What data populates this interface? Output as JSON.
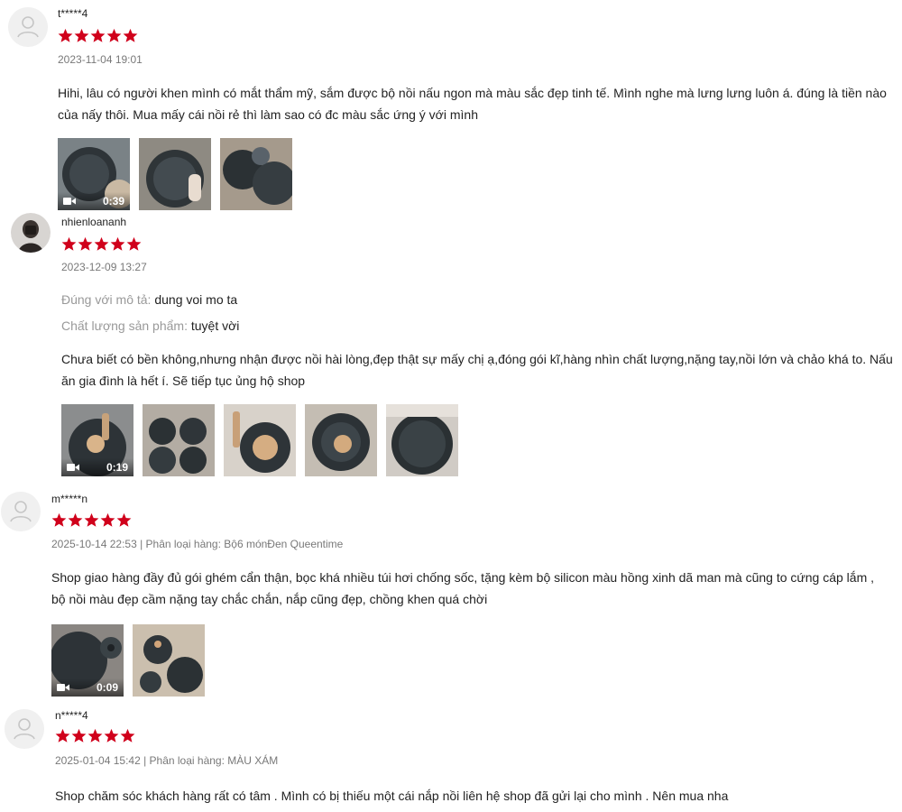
{
  "colors": {
    "star": "#d0011b",
    "meta": "#757575",
    "label": "#999999"
  },
  "reviews": [
    {
      "username": "t*****4",
      "rating": 5,
      "meta": "2023-11-04 19:01",
      "content": "Hihi, lâu có người khen mình có mắt thẩm mỹ, sắm được bộ nồi nấu ngon mà màu sắc đẹp tinh tế. Mình nghe mà lưng lưng luôn á. đúng là tiền nào của nấy thôi. Mua mấy cái nồi rẻ thì làm sao có đc màu sắc ứng ý với mình",
      "video_duration": "0:39"
    },
    {
      "username": "nhienloananh",
      "rating": 5,
      "meta": "2023-12-09 13:27",
      "attributes": [
        {
          "label": "Đúng với mô tả:",
          "value": "dung voi mo ta"
        },
        {
          "label": "Chất lượng sản phẩm:",
          "value": "tuyệt vời"
        }
      ],
      "content": "Chưa biết có bền không,nhưng nhận được nồi hài lòng,đẹp thật sự mấy chị ạ,đóng gói kĩ,hàng nhìn chất lượng,nặng tay,nồi lớn và chảo khá to. Nấu ăn gia đình là hết í. Sẽ tiếp tục ủng hộ shop",
      "video_duration": "0:19"
    },
    {
      "username": "m*****n",
      "rating": 5,
      "meta": "2025-10-14 22:53 | Phân loại hàng: Bộ6 mónĐen Queentime",
      "content": "Shop giao hàng đầy đủ gói ghém cẩn thận, bọc khá nhiều túi hơi chống sốc, tặng kèm bộ silicon màu hồng xinh dã man mà cũng to cứng cáp lắm , bộ nồi màu đẹp cầm nặng tay chắc chắn, nắp cũng đẹp, chồng khen quá chời",
      "video_duration": "0:09"
    },
    {
      "username": "n*****4",
      "rating": 5,
      "meta": "2025-01-04 15:42 | Phân loại hàng: MÀU XÁM",
      "content": "Shop chăm sóc khách hàng rất có tâm . Mình có bị thiếu một cái nắp nồi liên hệ shop đã gửi lại cho mình . Nên mua nha"
    }
  ]
}
